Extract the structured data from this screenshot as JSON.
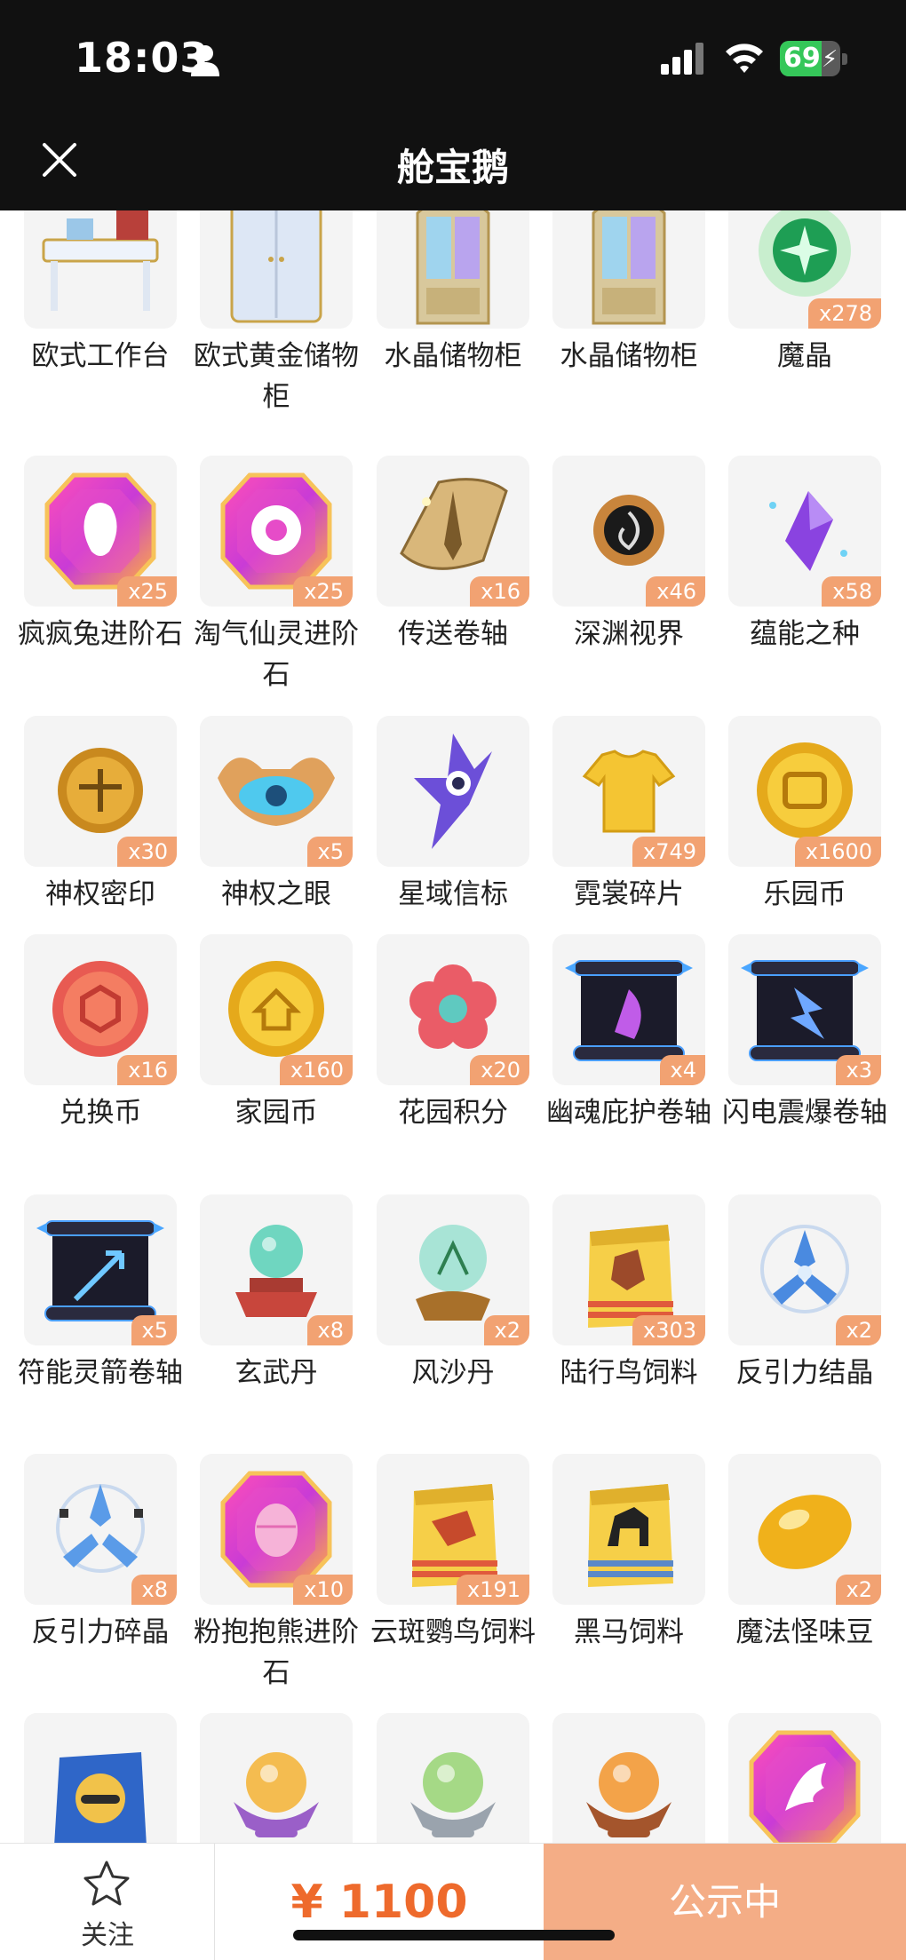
{
  "status_bar": {
    "time": "18:03",
    "battery": "69",
    "battery_level": 0.69
  },
  "header": {
    "title": "舱宝鹅"
  },
  "colors": {
    "badge": "#f2a272",
    "price": "#ee6a2c",
    "button": "#f4ad86"
  },
  "items": [
    {
      "name": "欧式工作台",
      "count": "",
      "icon": "desk"
    },
    {
      "name": "欧式黄金储物柜",
      "count": "",
      "icon": "wardrobe"
    },
    {
      "name": "水晶储物柜",
      "count": "",
      "icon": "crystal-cabinet"
    },
    {
      "name": "水晶储物柜",
      "count": "",
      "icon": "crystal-cabinet"
    },
    {
      "name": "魔晶",
      "count": "x278",
      "icon": "green-orb"
    },
    {
      "name": "疯疯兔进阶石",
      "count": "x25",
      "icon": "gem-rabbit"
    },
    {
      "name": "淘气仙灵进阶石",
      "count": "x25",
      "icon": "gem-fairy"
    },
    {
      "name": "传送卷轴",
      "count": "x16",
      "icon": "scroll-gold"
    },
    {
      "name": "深渊视界",
      "count": "x46",
      "icon": "abyss-sun"
    },
    {
      "name": "蕴能之种",
      "count": "x58",
      "icon": "purple-crystal"
    },
    {
      "name": "神权密印",
      "count": "x30",
      "icon": "gold-seal"
    },
    {
      "name": "神权之眼",
      "count": "x5",
      "icon": "winged-eye"
    },
    {
      "name": "星域信标",
      "count": "",
      "icon": "star-beacon"
    },
    {
      "name": "霓裳碎片",
      "count": "x749",
      "icon": "shirt"
    },
    {
      "name": "乐园币",
      "count": "x1600",
      "icon": "gold-coin"
    },
    {
      "name": "兑换币",
      "count": "x16",
      "icon": "red-coin"
    },
    {
      "name": "家园币",
      "count": "x160",
      "icon": "home-coin"
    },
    {
      "name": "花园积分",
      "count": "x20",
      "icon": "flower"
    },
    {
      "name": "幽魂庇护卷轴",
      "count": "x4",
      "icon": "scroll-purple"
    },
    {
      "name": "闪电震爆卷轴",
      "count": "x3",
      "icon": "scroll-blue"
    },
    {
      "name": "符能灵箭卷轴",
      "count": "x5",
      "icon": "scroll-arrow"
    },
    {
      "name": "玄武丹",
      "count": "x8",
      "icon": "pill-stand"
    },
    {
      "name": "风沙丹",
      "count": "x2",
      "icon": "glass-orb"
    },
    {
      "name": "陆行鸟饲料",
      "count": "x303",
      "icon": "feed-bag-bird"
    },
    {
      "name": "反引力结晶",
      "count": "x2",
      "icon": "antigrav-crystal"
    },
    {
      "name": "反引力碎晶",
      "count": "x8",
      "icon": "antigrav-shard"
    },
    {
      "name": "粉抱抱熊进阶石",
      "count": "x10",
      "icon": "gem-egg"
    },
    {
      "name": "云斑鹦鸟饲料",
      "count": "x191",
      "icon": "feed-bag-red"
    },
    {
      "name": "黑马饲料",
      "count": "",
      "icon": "feed-bag-horse"
    },
    {
      "name": "魔法怪味豆",
      "count": "x2",
      "icon": "bean"
    },
    {
      "name": "",
      "count": "",
      "icon": "pet-bag"
    },
    {
      "name": "",
      "count": "",
      "icon": "orb-purple"
    },
    {
      "name": "",
      "count": "",
      "icon": "orb-silver"
    },
    {
      "name": "",
      "count": "",
      "icon": "orb-bronze"
    },
    {
      "name": "",
      "count": "",
      "icon": "gem-wing"
    }
  ],
  "bottom_bar": {
    "follow_label": "关注",
    "price": "¥ 1100",
    "status_button": "公示中"
  }
}
